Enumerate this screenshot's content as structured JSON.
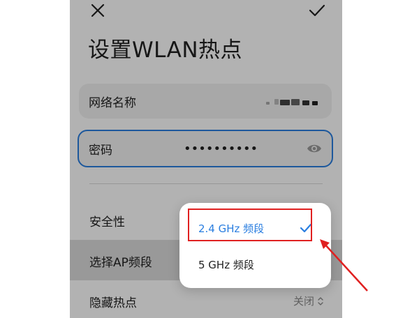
{
  "screen": {
    "title": "设置WLAN热点",
    "network_name_label": "网络名称",
    "password_label": "密码",
    "password_mask": "••••••••••",
    "security_label": "安全性",
    "ap_band_label": "选择AP频段",
    "hide_hotspot_label": "隐藏热点",
    "hide_hotspot_value": "关闭"
  },
  "band_menu": {
    "options": [
      {
        "label": "2.4 GHz 频段",
        "selected": true
      },
      {
        "label": "5 GHz 频段",
        "selected": false
      }
    ]
  },
  "colors": {
    "accent": "#2a7ee0",
    "annotation": "#e02020"
  },
  "icons": [
    "close-icon",
    "check-icon",
    "eye-icon",
    "chevron-updown-icon"
  ]
}
